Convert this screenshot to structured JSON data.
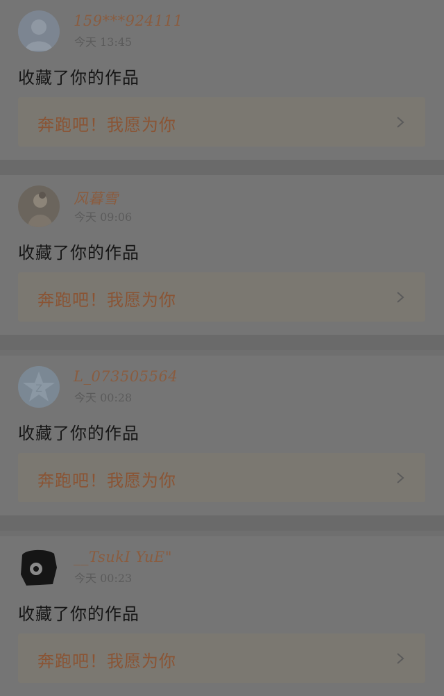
{
  "feed": {
    "items": [
      {
        "username": "159***924111",
        "time": "今天 13:45",
        "action": "收藏了你的作品",
        "work_title": "奔跑吧！我愿为你",
        "avatar": "default-person-avatar"
      },
      {
        "username": "风暮雪",
        "time": "今天 09:06",
        "action": "收藏了你的作品",
        "work_title": "奔跑吧！我愿为你",
        "avatar": "photo-avatar"
      },
      {
        "username": "L_073505564",
        "time": "今天 00:28",
        "action": "收藏了你的作品",
        "work_title": "奔跑吧！我愿为你",
        "avatar": "qq-star-avatar"
      },
      {
        "username": "__TsukI YuE\"",
        "time": "今天 00:23",
        "action": "收藏了你的作品",
        "work_title": "奔跑吧！我愿为你",
        "avatar": "dark-photo-avatar"
      }
    ]
  },
  "colors": {
    "overlay_background": "#6f6f6f",
    "username": "#8a5c3f",
    "work_title": "#8a5434",
    "action_text": "#151515",
    "time_text": "#5b5b5b"
  },
  "icons": {
    "chevron": "chevron-right-icon"
  }
}
